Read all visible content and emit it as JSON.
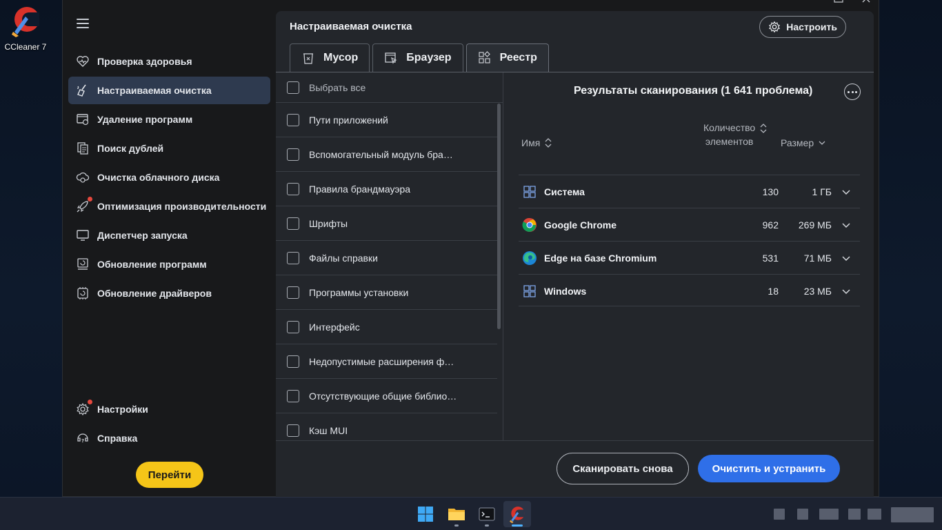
{
  "desktop": {
    "icon_label": "CCleaner 7"
  },
  "sidebar": {
    "items": [
      {
        "label": "Проверка здоровья",
        "icon": "heart-icon"
      },
      {
        "label": "Настраиваемая очистка",
        "icon": "broom-icon",
        "active": true
      },
      {
        "label": "Удаление программ",
        "icon": "uninstall-icon"
      },
      {
        "label": "Поиск дублей",
        "icon": "duplicate-icon"
      },
      {
        "label": "Очистка облачного диска",
        "icon": "cloud-drive-icon"
      },
      {
        "label": "Оптимизация производительности",
        "icon": "rocket-icon"
      },
      {
        "label": "Диспетчер запуска",
        "icon": "monitor-icon"
      },
      {
        "label": "Обновление программ",
        "icon": "software-update-icon"
      },
      {
        "label": "Обновление драйверов",
        "icon": "driver-update-icon"
      }
    ],
    "bottom": [
      {
        "label": "Настройки",
        "icon": "settings-icon"
      },
      {
        "label": "Справка",
        "icon": "help-icon"
      }
    ],
    "go_button": "Перейти"
  },
  "main": {
    "title": "Настраиваемая очистка",
    "customize_button": "Настроить",
    "tabs": [
      {
        "label": "Мусор",
        "icon": "trash-icon"
      },
      {
        "label": "Браузер",
        "icon": "browser-icon"
      },
      {
        "label": "Реестр",
        "icon": "registry-icon",
        "active": true
      }
    ],
    "select_all": "Выбрать все",
    "list": [
      "Пути приложений",
      "Вспомогательный модуль бра…",
      "Правила брандмауэра",
      "Шрифты",
      "Файлы справки",
      "Программы установки",
      "Интерфейс",
      "Недопустимые расширения ф…",
      "Отсутствующие общие библио…",
      "Кэш MUI"
    ]
  },
  "results": {
    "title": "Результаты сканирования (1 641 проблема)",
    "col_name": "Имя",
    "col_count_line1": "Количество",
    "col_count_line2": "элементов",
    "col_size": "Размер",
    "rows": [
      {
        "name": "Система",
        "count": "130",
        "size": "1 ГБ",
        "icon": "windows-icon"
      },
      {
        "name": "Google Chrome",
        "count": "962",
        "size": "269 МБ",
        "icon": "chrome-icon"
      },
      {
        "name": "Edge на базе Chromium",
        "count": "531",
        "size": "71 МБ",
        "icon": "edge-icon"
      },
      {
        "name": "Windows",
        "count": "18",
        "size": "23 МБ",
        "icon": "windows-icon"
      }
    ]
  },
  "footer": {
    "rescan_button": "Сканировать снова",
    "fix_button": "Очистить и устранить"
  },
  "colors": {
    "accent_blue": "#2f6fe8",
    "go_yellow": "#f5c518",
    "active_nav": "#2e3a4f"
  }
}
